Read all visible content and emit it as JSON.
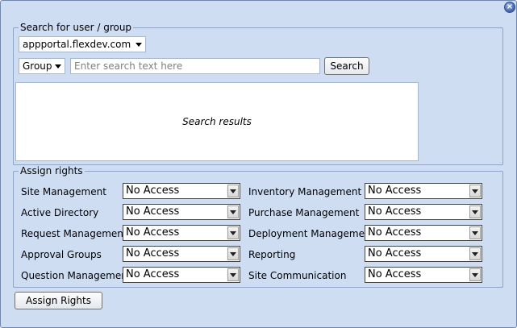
{
  "search": {
    "legend": "Search for user / group",
    "domain_value": "appportal.flexdev.com",
    "type_value": "Group",
    "placeholder": "Enter search text here",
    "button_label": "Search",
    "results_placeholder": "Search results"
  },
  "rights": {
    "legend": "Assign rights",
    "left": [
      {
        "label": "Site Management",
        "value": "No Access"
      },
      {
        "label": "Active Directory",
        "value": "No Access"
      },
      {
        "label": "Request Management",
        "value": "No Access"
      },
      {
        "label": "Approval Groups",
        "value": "No Access"
      },
      {
        "label": "Question Management",
        "value": "No Access"
      }
    ],
    "right": [
      {
        "label": "Inventory Management",
        "value": "No Access"
      },
      {
        "label": "Purchase Management",
        "value": "No Access"
      },
      {
        "label": "Deployment Management",
        "value": "No Access"
      },
      {
        "label": "Reporting",
        "value": "No Access"
      },
      {
        "label": "Site Communication",
        "value": "No Access"
      }
    ],
    "assign_button_label": "Assign Rights"
  },
  "window": {
    "close_glyph": "×"
  }
}
